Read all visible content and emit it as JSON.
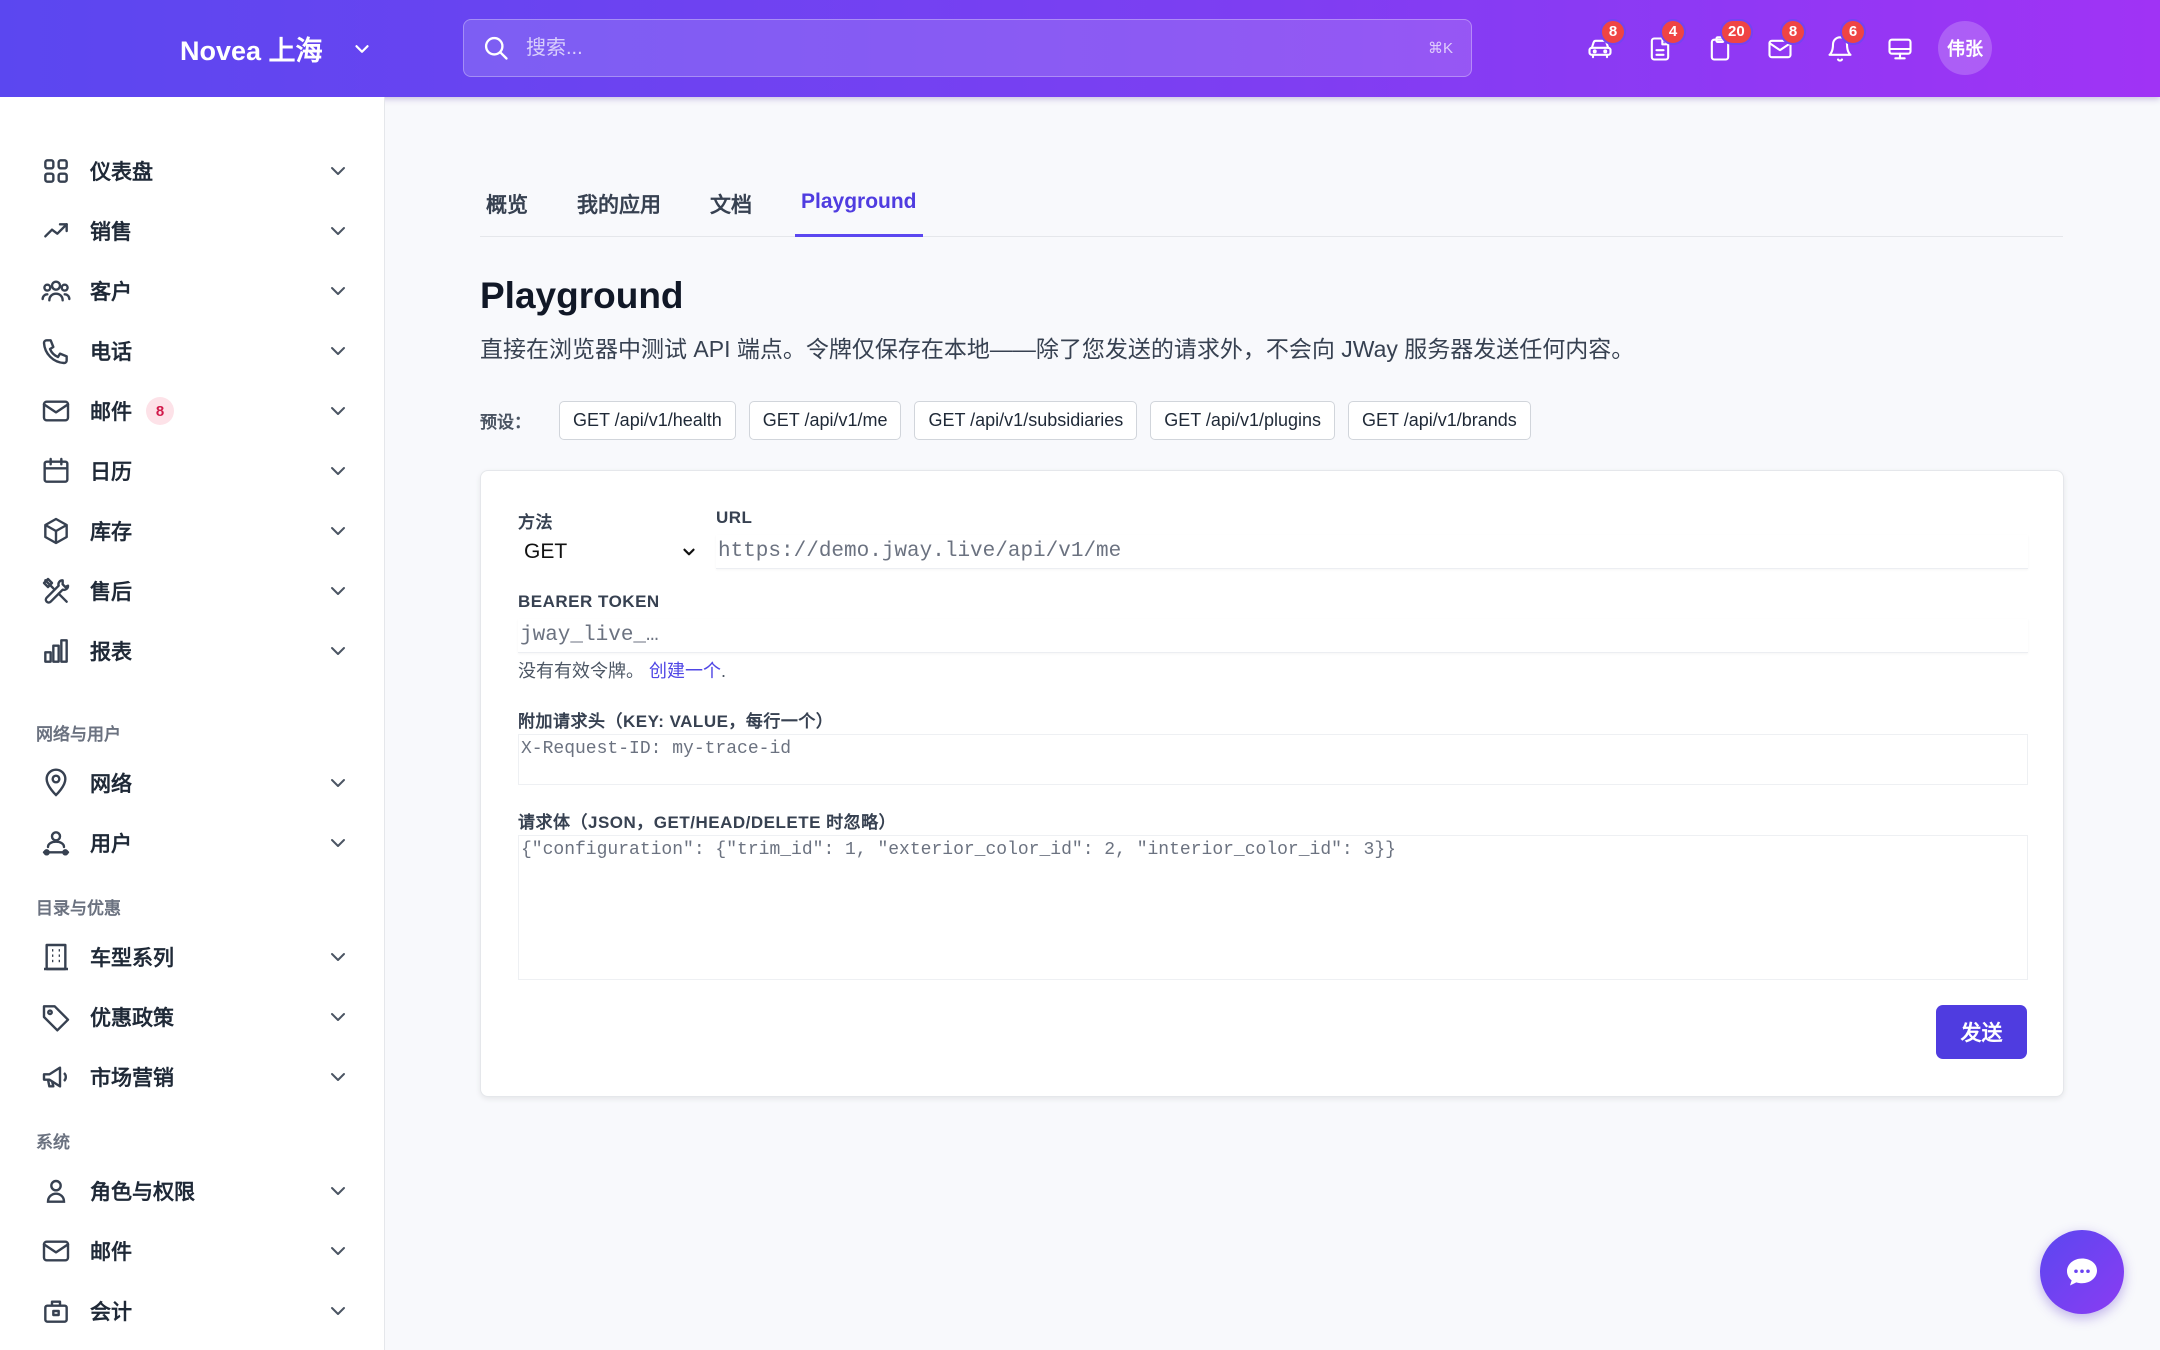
{
  "header": {
    "brand": "Novea 上海",
    "search_placeholder": "搜索...",
    "search_shortcut": "⌘K",
    "icons": [
      {
        "name": "car-icon",
        "badge": "8"
      },
      {
        "name": "document-icon",
        "badge": "4"
      },
      {
        "name": "clipboard-icon",
        "badge": "20"
      },
      {
        "name": "mail-icon",
        "badge": "8"
      },
      {
        "name": "bell-icon",
        "badge": "6"
      },
      {
        "name": "monitor-icon",
        "badge": ""
      }
    ],
    "avatar": "伟张"
  },
  "sidebar": {
    "items_main": [
      {
        "label": "仪表盘",
        "icon": "grid-icon"
      },
      {
        "label": "销售",
        "icon": "trending-up-icon"
      },
      {
        "label": "客户",
        "icon": "users-icon"
      },
      {
        "label": "电话",
        "icon": "phone-icon"
      },
      {
        "label": "邮件",
        "icon": "mail-icon",
        "badge": "8"
      },
      {
        "label": "日历",
        "icon": "calendar-icon"
      },
      {
        "label": "库存",
        "icon": "box-icon"
      },
      {
        "label": "售后",
        "icon": "tools-icon"
      },
      {
        "label": "报表",
        "icon": "bar-chart-icon"
      }
    ],
    "section_network": "网络与用户",
    "items_network": [
      {
        "label": "网络",
        "icon": "map-pin-icon"
      },
      {
        "label": "用户",
        "icon": "user-network-icon"
      }
    ],
    "section_catalog": "目录与优惠",
    "items_catalog": [
      {
        "label": "车型系列",
        "icon": "building-icon"
      },
      {
        "label": "优惠政策",
        "icon": "tag-icon"
      },
      {
        "label": "市场营销",
        "icon": "megaphone-icon"
      }
    ],
    "section_system": "系统",
    "items_system": [
      {
        "label": "角色与权限",
        "icon": "user-icon"
      },
      {
        "label": "邮件",
        "icon": "mail-icon"
      },
      {
        "label": "会计",
        "icon": "briefcase-icon"
      }
    ]
  },
  "tabs": [
    "概览",
    "我的应用",
    "文档",
    "Playground"
  ],
  "active_tab": "Playground",
  "page": {
    "title": "Playground",
    "subtitle": "直接在浏览器中测试 API 端点。令牌仅保存在本地——除了您发送的请求外，不会向 JWay 服务器发送任何内容。"
  },
  "presets": {
    "label": "预设：",
    "items": [
      "GET /api/v1/health",
      "GET /api/v1/me",
      "GET /api/v1/subsidiaries",
      "GET /api/v1/plugins",
      "GET /api/v1/brands"
    ]
  },
  "form": {
    "method_label": "方法",
    "method_value": "GET",
    "url_label": "URL",
    "url_placeholder": "https://demo.jway.live/api/v1/me",
    "token_label": "BEARER TOKEN",
    "token_placeholder": "jway_live_…",
    "token_hint": "没有有效令牌。",
    "token_hint_link": "创建一个",
    "token_hint_end": ".",
    "headers_label": "附加请求头（KEY: VALUE，每行一个）",
    "headers_placeholder": "X-Request-ID: my-trace-id",
    "body_label": "请求体（JSON，GET/HEAD/DELETE 时忽略）",
    "body_placeholder": "{\"configuration\": {\"trim_id\": 1, \"exterior_color_id\": 2, \"interior_color_id\": 3}}",
    "send_label": "发送"
  }
}
